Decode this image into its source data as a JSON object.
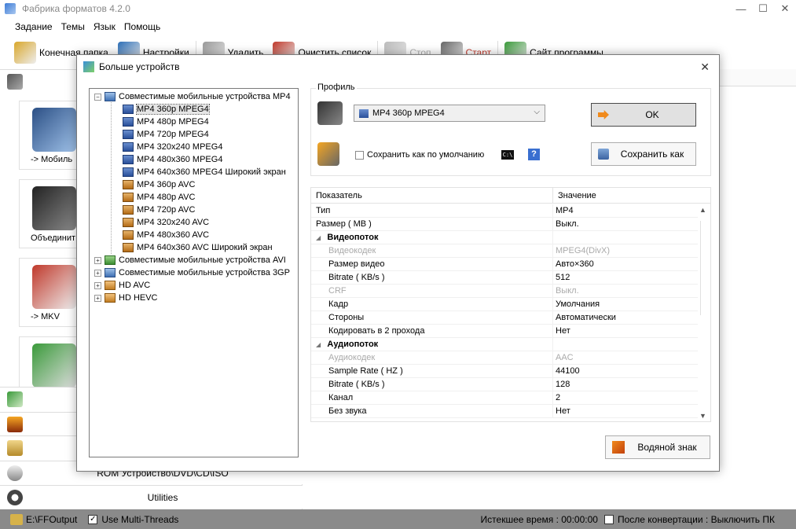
{
  "window": {
    "title": "Фабрика форматов 4.2.0",
    "controls": [
      "—",
      "☐",
      "✕"
    ]
  },
  "menu": [
    "Задание",
    "Темы",
    "Язык",
    "Помощь"
  ],
  "toolbar": {
    "items": [
      {
        "label": "Конечная папка",
        "icon": "folder-icon",
        "color": "#d9a72b"
      },
      {
        "label": "Настройки",
        "icon": "settings-icon",
        "color": "#2d6fb7"
      },
      {
        "label": "Удалить",
        "icon": "delete-icon",
        "color": "#999999"
      },
      {
        "label": "Очистить список",
        "icon": "clear-list-icon",
        "color": "#c0392b"
      },
      {
        "label": "Стоп",
        "icon": "stop-icon",
        "color": "#bbbbbb",
        "disabled": true
      },
      {
        "label": "Старт",
        "icon": "start-icon",
        "color": "#666666",
        "accent_text": "#c0392b"
      },
      {
        "label": "Сайт программы",
        "icon": "globe-icon",
        "color": "#3a9a3a"
      }
    ]
  },
  "left_panel": {
    "tiles": [
      {
        "label": "-> Мобиль"
      },
      {
        "label": "Объединит"
      },
      {
        "label": "-> MKV"
      },
      {
        "label": ""
      }
    ],
    "categories": [
      {
        "label": ""
      },
      {
        "label": ""
      },
      {
        "label": ""
      },
      {
        "label": "ROM Устройство\\DVD\\CD\\ISO"
      },
      {
        "label": "Utilities"
      }
    ]
  },
  "status": {
    "folder": "E:\\FFOutput",
    "multithreads_label": "Use Multi-Threads",
    "multithreads_checked": true,
    "elapsed": "Истекшее время : 00:00:00",
    "after_convert": "После конвертации : Выключить ПК",
    "after_convert_checked": false
  },
  "dialog": {
    "title": "Больше устройств",
    "close": "✕",
    "tree": [
      {
        "label": "Совместимые мобильные устройства MP4",
        "expander": "−",
        "level": 0,
        "kind": "grp"
      },
      {
        "label": "MP4 360p MPEG4",
        "level": 1,
        "kind": "mpeg",
        "selected": true
      },
      {
        "label": "MP4 480p MPEG4",
        "level": 1,
        "kind": "mpeg"
      },
      {
        "label": "MP4 720p MPEG4",
        "level": 1,
        "kind": "mpeg"
      },
      {
        "label": "MP4 320x240 MPEG4",
        "level": 1,
        "kind": "mpeg"
      },
      {
        "label": "MP4 480x360 MPEG4",
        "level": 1,
        "kind": "mpeg"
      },
      {
        "label": "MP4 640x360 MPEG4 Широкий экран",
        "level": 1,
        "kind": "mpeg"
      },
      {
        "label": "MP4 360p AVC",
        "level": 1,
        "kind": "avc"
      },
      {
        "label": "MP4 480p AVC",
        "level": 1,
        "kind": "avc"
      },
      {
        "label": "MP4 720p AVC",
        "level": 1,
        "kind": "avc"
      },
      {
        "label": "MP4 320x240 AVC",
        "level": 1,
        "kind": "avc"
      },
      {
        "label": "MP4 480x360 AVC",
        "level": 1,
        "kind": "avc"
      },
      {
        "label": "MP4 640x360 AVC Широкий экран",
        "level": 1,
        "kind": "avc"
      },
      {
        "label": "Совместимые мобильные устройства AVI",
        "expander": "+",
        "level": 0,
        "kind": "grp2"
      },
      {
        "label": "Совместимые мобильные устройства 3GP",
        "expander": "+",
        "level": 0,
        "kind": "grp"
      },
      {
        "label": "HD AVC",
        "expander": "+",
        "level": 0,
        "kind": "grp3"
      },
      {
        "label": "HD HEVC",
        "expander": "+",
        "level": 0,
        "kind": "grp3"
      }
    ],
    "profile": {
      "group_label": "Профиль",
      "selected": "MP4 360p MPEG4",
      "save_default_label": "Сохранить как по умолчанию",
      "save_default_checked": false,
      "cmd_icon_text": "C:\\",
      "help_text": "?"
    },
    "buttons": {
      "ok": "OK",
      "save_as": "Сохранить как",
      "watermark": "Водяной знак"
    },
    "grid": {
      "col_param": "Показатель",
      "col_value": "Значение",
      "rows": [
        {
          "k": "Тип",
          "v": "MP4",
          "indent": 0
        },
        {
          "k": "Размер ( MB )",
          "v": "Выкл.",
          "indent": 0
        },
        {
          "k": "Видеопоток",
          "v": "",
          "section": true
        },
        {
          "k": "Видеокодек",
          "v": "MPEG4(DivX)",
          "indent": 1,
          "disabled": true
        },
        {
          "k": "Размер видео",
          "v": "Авто×360",
          "indent": 1
        },
        {
          "k": "Bitrate ( KB/s )",
          "v": "512",
          "indent": 1
        },
        {
          "k": "CRF",
          "v": "Выкл.",
          "indent": 1,
          "disabled": true
        },
        {
          "k": "Кадр",
          "v": "Умолчания",
          "indent": 1
        },
        {
          "k": "Стороны",
          "v": "Автоматически",
          "indent": 1
        },
        {
          "k": "Кодировать в 2 прохода",
          "v": "Нет",
          "indent": 1
        },
        {
          "k": "Аудиопоток",
          "v": "",
          "section": true
        },
        {
          "k": "Аудиокодек",
          "v": "AAC",
          "indent": 1,
          "disabled": true
        },
        {
          "k": "Sample Rate ( HZ )",
          "v": "44100",
          "indent": 1
        },
        {
          "k": "Bitrate ( KB/s )",
          "v": "128",
          "indent": 1
        },
        {
          "k": "Канал",
          "v": "2",
          "indent": 1
        },
        {
          "k": "Без звука",
          "v": "Нет",
          "indent": 1
        }
      ]
    }
  }
}
